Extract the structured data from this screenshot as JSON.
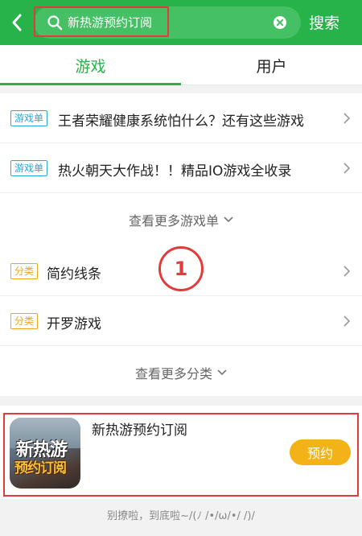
{
  "header": {
    "search_value": "新热游预约订阅",
    "search_button": "搜索"
  },
  "tabs": [
    {
      "label": "游戏",
      "active": true
    },
    {
      "label": "用户",
      "active": false
    }
  ],
  "game_lists": [
    {
      "badge": "游戏单",
      "title": "王者荣耀健康系统怕什么？还有这些游戏"
    },
    {
      "badge": "游戏单",
      "title": "热火朝天大作战！！精品IO游戏全收录"
    }
  ],
  "more_game_lists": "查看更多游戏单",
  "categories": [
    {
      "badge": "分类",
      "title": "简约线条"
    },
    {
      "badge": "分类",
      "title": "开罗游戏"
    }
  ],
  "more_categories": "查看更多分类",
  "annotation_marker": "1",
  "game_card": {
    "icon_line1": "新热游",
    "icon_line2": "预约订阅",
    "title": "新热游预约订阅",
    "action": "预约"
  },
  "footer": "别撩啦，到底啦~/(ﾉ /•/ω/•/ /)/",
  "colors": {
    "brand_green": "#27b24a",
    "highlight_red": "#e23b3b",
    "badge_blue": "#2aa7dd",
    "badge_orange": "#f1a31f",
    "reserve_yellow": "#f3b318"
  }
}
